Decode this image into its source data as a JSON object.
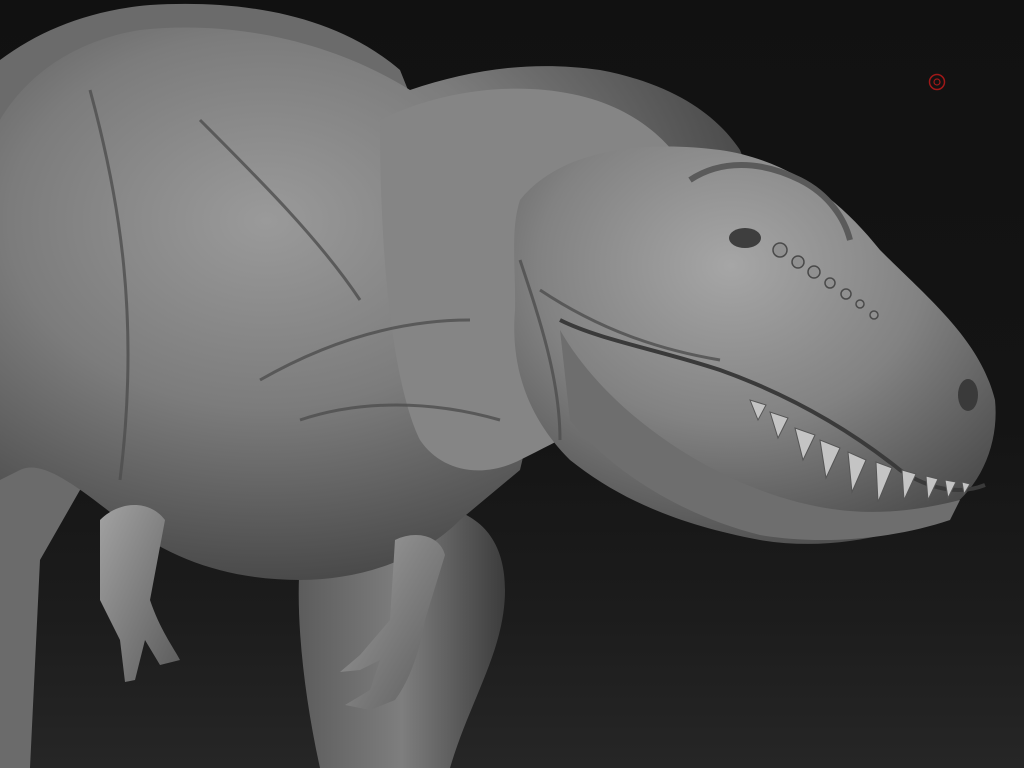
{
  "app": {
    "name": "sculpting-viewport"
  },
  "viewport": {
    "background_color": "#121212",
    "floor_gradient_color": "#262626",
    "model": {
      "subject": "tyrannosaurus-rex-sculpt",
      "material_color": "#7a7a7a",
      "highlight_color": "#a9a9a9",
      "shadow_color": "#2a2a2a"
    }
  },
  "brush_cursor": {
    "icon": "brush-cursor-icon",
    "color": "#a01818"
  }
}
